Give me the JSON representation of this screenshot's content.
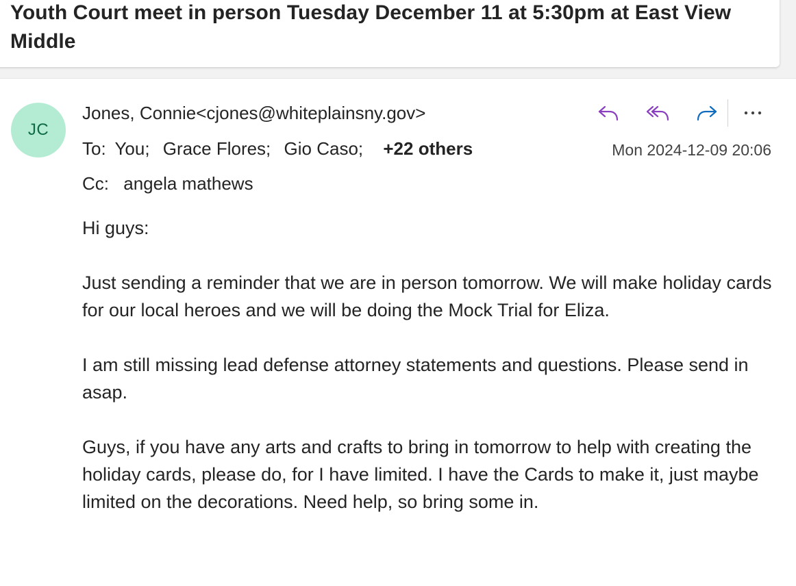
{
  "subject": "Youth Court meet in person Tuesday December 11 at 5:30pm at East View Middle",
  "sender": {
    "initials": "JC",
    "display": "Jones, Connie<cjones@whiteplainsny.gov>",
    "avatar_color": "#b4ecd3"
  },
  "recipients": {
    "to_label": "To:",
    "to": [
      "You;",
      "Grace Flores;",
      "Gio Caso;"
    ],
    "others": "+22 others",
    "cc_label": "Cc:",
    "cc": "angela mathews"
  },
  "timestamp": "Mon 2024-12-09 20:06",
  "actions": {
    "reply": "reply-icon",
    "reply_all": "reply-all-icon",
    "forward": "forward-icon",
    "more": "more-icon",
    "accent_purple": "#8a3fbf",
    "accent_blue": "#0f6cbd"
  },
  "body": {
    "greeting": "Hi guys:",
    "p1": "Just sending a reminder that we are in person tomorrow. We will make holiday cards for our local heroes and we will be doing the Mock Trial for Eliza.",
    "p2": "I am still missing lead defense attorney statements and questions. Please send in asap.",
    "p3": "Guys, if you have any arts and crafts to bring in tomorrow to help with creating the holiday cards, please do, for I have limited. I have the Cards to make it, just maybe limited on the decorations. Need help, so bring some in."
  }
}
